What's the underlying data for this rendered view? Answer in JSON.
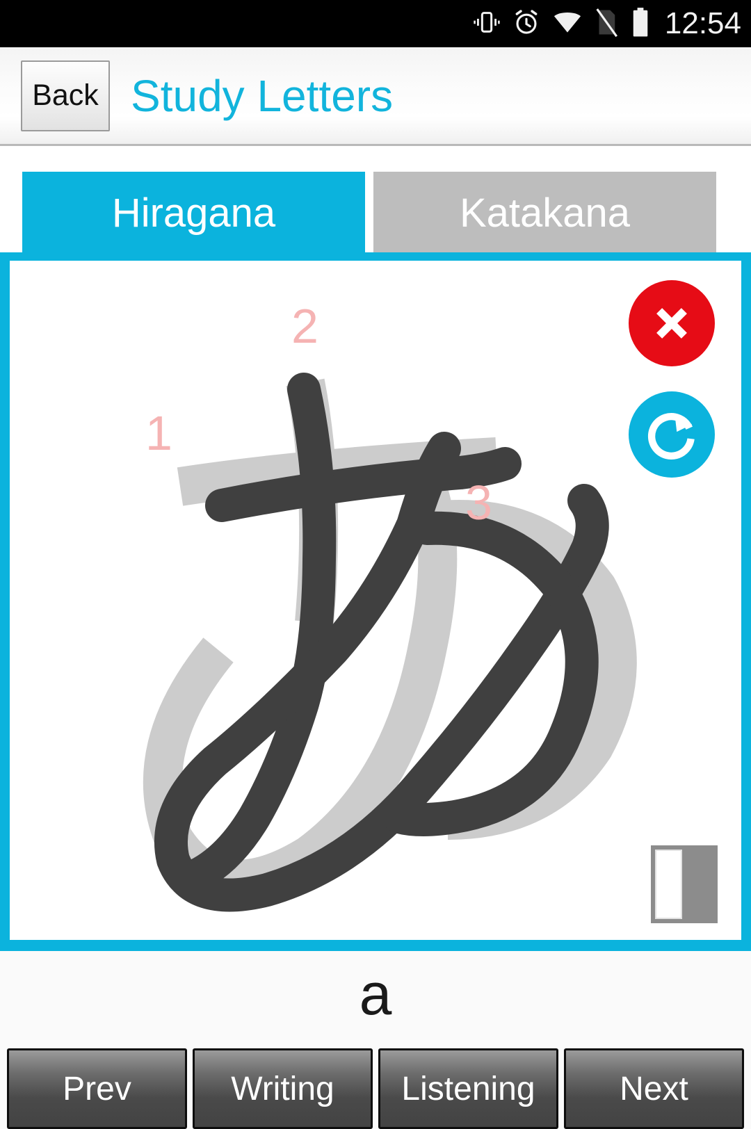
{
  "statusbar": {
    "time": "12:54",
    "icons": [
      {
        "name": "vibrate-icon",
        "label": "vibrate"
      },
      {
        "name": "alarm-icon",
        "label": "alarm"
      },
      {
        "name": "wifi-icon",
        "label": "wifi"
      },
      {
        "name": "no-sim-icon",
        "label": "no sim"
      },
      {
        "name": "battery-icon",
        "label": "battery full"
      }
    ]
  },
  "header": {
    "back_label": "Back",
    "title": "Study Letters",
    "title_color": "#12b4dc"
  },
  "tabs": [
    {
      "label": "Hiragana",
      "active": true,
      "color": "#0bb3dd"
    },
    {
      "label": "Katakana",
      "active": false,
      "color": "#bdbdbd"
    }
  ],
  "canvas": {
    "frame_color": "#0bb3dd",
    "background": "#ffffff",
    "character": "あ",
    "template_color": "#cccccc",
    "ink_color": "#404040",
    "stroke_number_color": "#f5b3b3",
    "stroke_numbers": [
      "1",
      "2",
      "3"
    ],
    "clear_button": {
      "name": "clear",
      "color": "#e60c16",
      "glyph": "✕"
    },
    "redo_button": {
      "name": "redo",
      "color": "#0bb3dd",
      "glyph": "↻"
    },
    "page_indicator": {
      "name": "page-indicator",
      "color": "#8c8c8c"
    }
  },
  "romaji": "a",
  "buttons": [
    {
      "label": "Prev"
    },
    {
      "label": "Writing"
    },
    {
      "label": "Listening"
    },
    {
      "label": "Next"
    }
  ]
}
